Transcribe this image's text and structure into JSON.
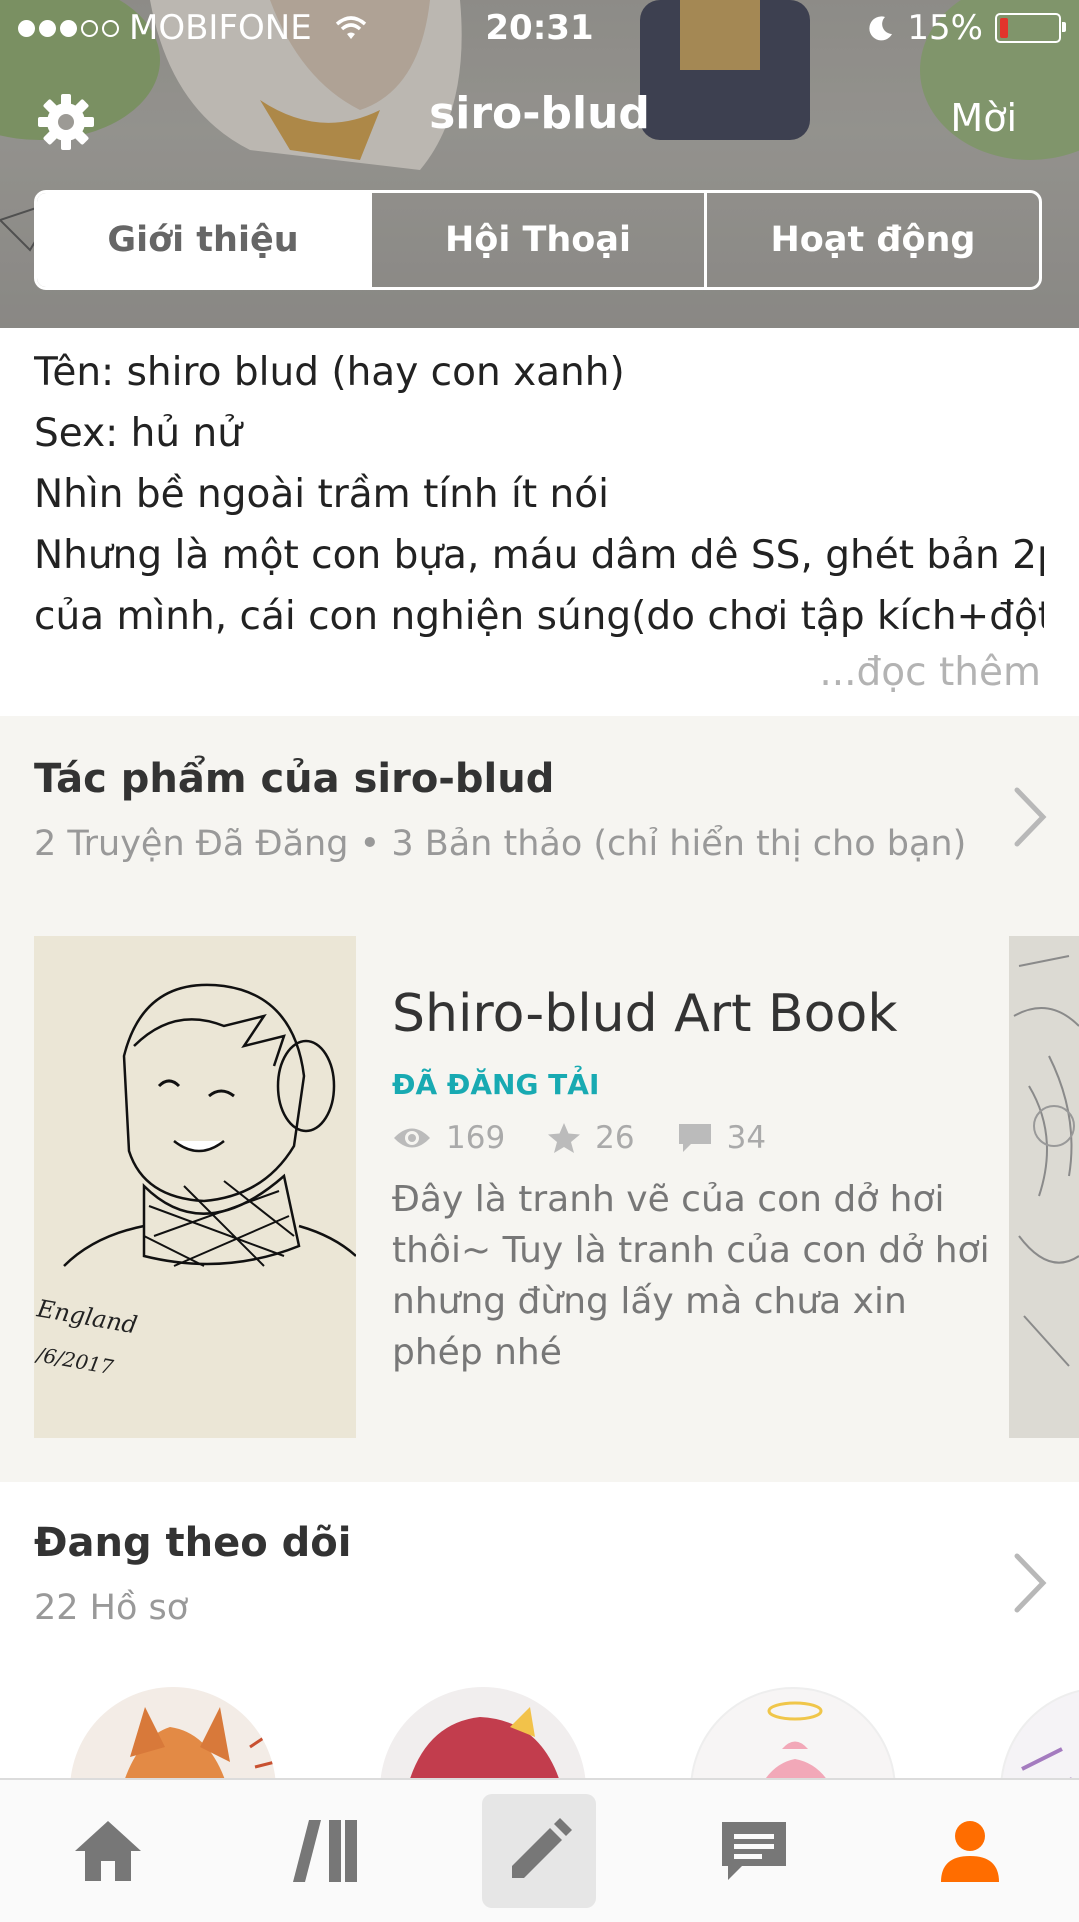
{
  "status_bar": {
    "carrier": "MOBIFONE",
    "time": "20:31",
    "battery": "15%",
    "battery_level": 0.15,
    "signal_bars": 3,
    "signal_total": 5
  },
  "header": {
    "title": "siro-blud",
    "invite_label": "Mời",
    "settings_icon": "gear-icon"
  },
  "tabs": [
    {
      "label": "Giới thiệu",
      "active": true
    },
    {
      "label": "Hội Thoại",
      "active": false
    },
    {
      "label": "Hoạt động",
      "active": false
    }
  ],
  "bio": {
    "lines": [
      "Tên: shiro blud (hay con xanh)",
      "Sex: hủ nử",
      "Nhìn bề ngoài trầm tính ít nói",
      "Nhưng là một con bựa, máu dâm dê SS, ghét bản 2p",
      "của mình, cái con nghiện súng(do chơi tập kích+đột"
    ],
    "read_more": "...đọc thêm"
  },
  "works": {
    "title": "Tác phẩm của siro-blud",
    "subtitle": "2 Truyện Đã Đăng • 3 Bản thảo (chỉ hiển thị cho bạn)",
    "story": {
      "title": "Shiro-blud Art Book",
      "status": "ĐÃ ĐĂNG TẢI",
      "reads": "169",
      "votes": "26",
      "comments": "34",
      "description": "Đây là tranh vẽ của con dở hơi thôi~ Tuy là tranh của con dở hơi nhưng đừng lấy mà chưa xin phép nhé",
      "cover_text_1": "England",
      "cover_text_2": "/6/2017"
    }
  },
  "following": {
    "title": "Đang theo dõi",
    "subtitle": "22 Hồ sơ"
  },
  "tabbar": {
    "items": [
      "home-icon",
      "library-icon",
      "write-icon",
      "messages-icon",
      "profile-icon"
    ],
    "active": "profile-icon",
    "accent": "#ff6d00"
  },
  "colors": {
    "accent_teal": "#18aab2",
    "section_bg": "#f6f5f1"
  }
}
